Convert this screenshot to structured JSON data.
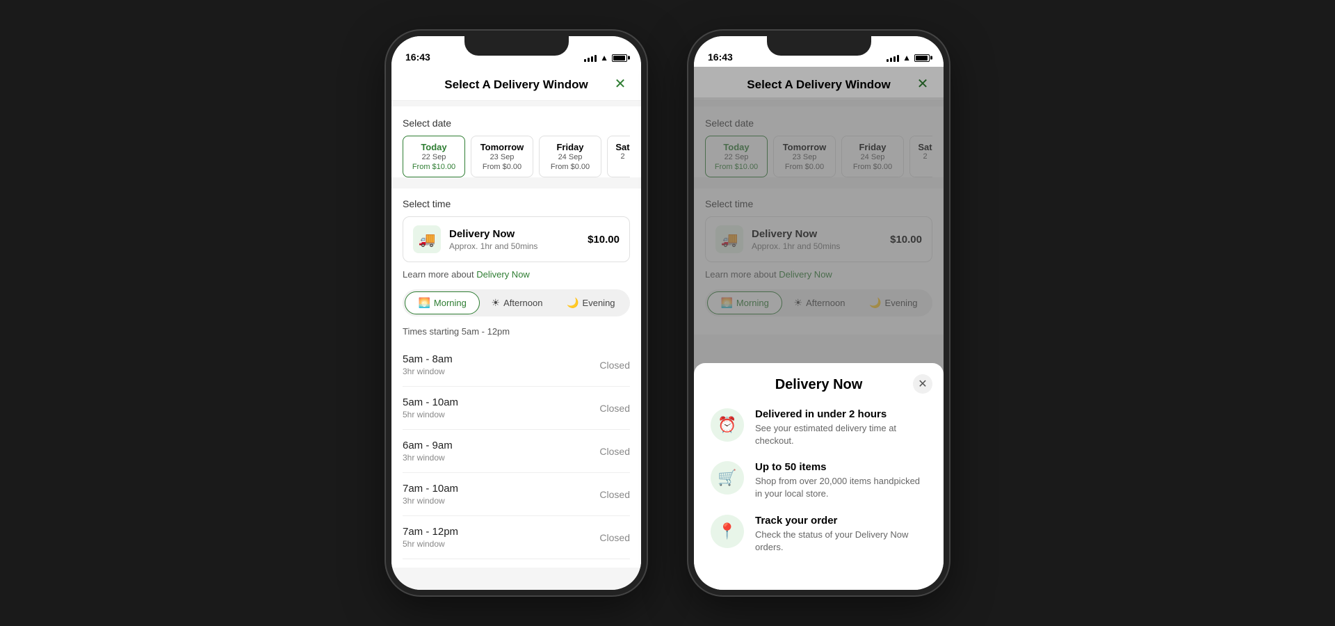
{
  "app": {
    "title": "Select A Delivery Window",
    "close_label": "✕",
    "time_status": "16:43"
  },
  "phone1": {
    "status_time": "16:43",
    "select_date_label": "Select date",
    "dates": [
      {
        "day": "Today",
        "date": "22 Sep",
        "price": "From $10.00",
        "selected": true
      },
      {
        "day": "Tomorrow",
        "date": "23 Sep",
        "price": "From $0.00",
        "selected": false
      },
      {
        "day": "Friday",
        "date": "24 Sep",
        "price": "From $0.00",
        "selected": false
      },
      {
        "day": "Sat",
        "date": "2",
        "partial": true
      }
    ],
    "select_time_label": "Select time",
    "delivery_now": {
      "name": "Delivery Now",
      "approx": "Approx. 1hr and 50mins",
      "price": "$10.00"
    },
    "learn_more_prefix": "Learn more about ",
    "learn_more_link": "Delivery Now",
    "tabs": [
      {
        "label": "Morning",
        "icon": "🌅",
        "active": true
      },
      {
        "label": "Afternoon",
        "icon": "☀️",
        "active": false
      },
      {
        "label": "Evening",
        "icon": "🌙",
        "active": false
      }
    ],
    "time_range_hint": "Times starting 5am - 12pm",
    "time_slots": [
      {
        "time": "5am - 8am",
        "window": "3hr window",
        "status": "Closed"
      },
      {
        "time": "5am - 10am",
        "window": "5hr window",
        "status": "Closed"
      },
      {
        "time": "6am - 9am",
        "window": "3hr window",
        "status": "Closed"
      },
      {
        "time": "7am - 10am",
        "window": "3hr window",
        "status": "Closed"
      },
      {
        "time": "7am - 12pm",
        "window": "5hr window",
        "status": "Closed"
      }
    ]
  },
  "phone2": {
    "status_time": "16:43",
    "select_date_label": "Select date",
    "dates": [
      {
        "day": "Today",
        "date": "22 Sep",
        "price": "From $10.00",
        "selected": true
      },
      {
        "day": "Tomorrow",
        "date": "23 Sep",
        "price": "From $0.00",
        "selected": false
      },
      {
        "day": "Friday",
        "date": "24 Sep",
        "price": "From $0.00",
        "selected": false
      },
      {
        "day": "Sat",
        "date": "2",
        "partial": true
      }
    ],
    "select_time_label": "Select time",
    "delivery_now": {
      "name": "Delivery Now",
      "approx": "Approx. 1hr and 50mins",
      "price": "$10.00"
    },
    "learn_more_prefix": "Learn more about ",
    "learn_more_link": "Delivery Now",
    "tabs": [
      {
        "label": "Morning",
        "icon": "🌅",
        "active": true
      },
      {
        "label": "Afternoon",
        "icon": "☀️",
        "active": false
      },
      {
        "label": "Evening",
        "icon": "🌙",
        "active": false
      }
    ]
  },
  "popup": {
    "title": "Delivery Now",
    "close_label": "✕",
    "items": [
      {
        "icon": "⏰",
        "title": "Delivered in under 2 hours",
        "desc": "See your estimated delivery time at checkout."
      },
      {
        "icon": "🛒",
        "title": "Up to 50 items",
        "desc": "Shop from over 20,000 items handpicked in your local store."
      },
      {
        "icon": "📍",
        "title": "Track your order",
        "desc": "Check the status of your Delivery Now orders."
      }
    ]
  }
}
